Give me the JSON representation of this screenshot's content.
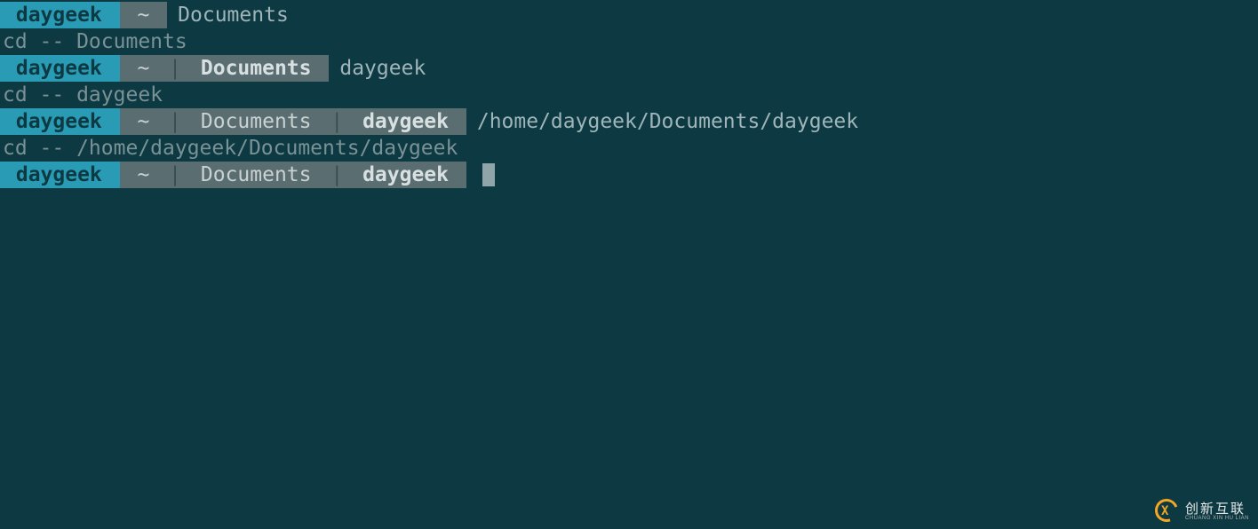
{
  "lines": [
    {
      "type": "prompt",
      "user": "daygeek",
      "segments": [
        {
          "text": "~",
          "bold": false
        }
      ],
      "input": "Documents"
    },
    {
      "type": "output",
      "text": "cd -- Documents"
    },
    {
      "type": "prompt",
      "user": "daygeek",
      "segments": [
        {
          "text": "~",
          "bold": false
        },
        {
          "text": "Documents",
          "bold": true
        }
      ],
      "input": "daygeek"
    },
    {
      "type": "output",
      "text": "cd -- daygeek"
    },
    {
      "type": "prompt",
      "user": "daygeek",
      "segments": [
        {
          "text": "~",
          "bold": false
        },
        {
          "text": "Documents",
          "bold": false
        },
        {
          "text": "daygeek",
          "bold": true
        }
      ],
      "input": "/home/daygeek/Documents/daygeek"
    },
    {
      "type": "output",
      "text": "cd -- /home/daygeek/Documents/daygeek"
    },
    {
      "type": "prompt",
      "user": "daygeek",
      "segments": [
        {
          "text": "~",
          "bold": false
        },
        {
          "text": "Documents",
          "bold": false
        },
        {
          "text": "daygeek",
          "bold": true
        }
      ],
      "input": "",
      "cursor": true
    }
  ],
  "watermark": {
    "cn": "创新互联",
    "en": "CHUANG XIN HU LIAN"
  }
}
